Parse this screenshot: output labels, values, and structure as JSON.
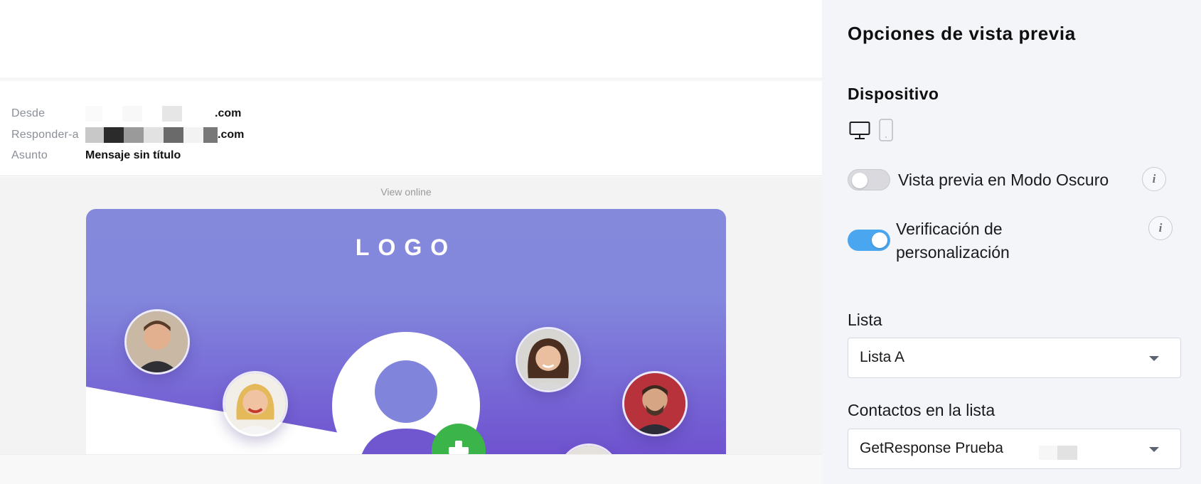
{
  "email_header": {
    "from_label": "Desde",
    "from_domain": ".com",
    "reply_label": "Responder-a",
    "reply_domain": ".com",
    "subject_label": "Asunto",
    "subject_value": "Mensaje sin título"
  },
  "email_body": {
    "view_online": "View online",
    "hero_logo": "LOGO"
  },
  "panel": {
    "title": "Opciones de vista previa",
    "device_title": "Dispositivo",
    "device_selected": "desktop",
    "dark_mode_label": "Vista previa en Modo Oscuro",
    "dark_mode_on": false,
    "personalization_label": "Verificación de personalización",
    "personalization_on": true,
    "info_icon_glyph": "i",
    "list_label": "Lista",
    "list_value": "Lista A",
    "contacts_label": "Contactos en la lista",
    "contacts_value": "GetResponse Prueba"
  },
  "colors": {
    "toggle_on": "#4aa6ee",
    "toggle_off": "#d9d9de",
    "hero_top": "#8589dc",
    "hero_bottom": "#6f52cf",
    "plus_badge": "#3bb54a",
    "panel_bg": "#f4f5f9"
  },
  "icons": [
    "desktop-icon",
    "mobile-icon",
    "info-icon",
    "chevron-down-icon",
    "plus-icon",
    "user-placeholder-icon"
  ]
}
